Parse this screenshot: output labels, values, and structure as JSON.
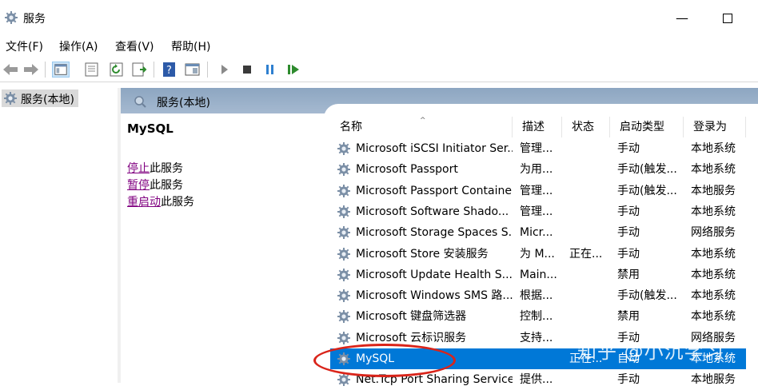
{
  "window": {
    "title": "服务"
  },
  "menu": [
    "文件(F)",
    "操作(A)",
    "查看(V)",
    "帮助(H)"
  ],
  "toolbar": [
    {
      "name": "back-arrow-icon"
    },
    {
      "name": "forward-arrow-icon"
    },
    {
      "name": "console-tree-icon"
    },
    {
      "name": "properties-sheet-icon"
    },
    {
      "name": "refresh-icon"
    },
    {
      "name": "export-list-icon"
    },
    {
      "name": "help-icon"
    },
    {
      "name": "view-icon"
    },
    {
      "name": "start-service-icon"
    },
    {
      "name": "stop-service-icon"
    },
    {
      "name": "pause-service-icon"
    },
    {
      "name": "resume-service-icon"
    }
  ],
  "tree": {
    "item": "服务(本地)"
  },
  "header": {
    "title": "服务(本地)"
  },
  "desc": {
    "service_name": "MySQL",
    "actions": [
      {
        "link": "停止",
        "rest": "此服务"
      },
      {
        "link": "暂停",
        "rest": "此服务"
      },
      {
        "link": "重启动",
        "rest": "此服务"
      }
    ]
  },
  "list": {
    "columns": [
      "名称",
      "描述",
      "状态",
      "启动类型",
      "登录为"
    ],
    "rows": [
      {
        "name": "Microsoft iSCSI Initiator Ser...",
        "desc": "管理...",
        "status": "",
        "startup": "手动",
        "logon": "本地系统"
      },
      {
        "name": "Microsoft Passport",
        "desc": "为用...",
        "status": "",
        "startup": "手动(触发...",
        "logon": "本地系统"
      },
      {
        "name": "Microsoft Passport Container",
        "desc": "管理...",
        "status": "",
        "startup": "手动(触发...",
        "logon": "本地服务"
      },
      {
        "name": "Microsoft Software Shado...",
        "desc": "管理...",
        "status": "",
        "startup": "手动",
        "logon": "本地系统"
      },
      {
        "name": "Microsoft Storage Spaces S...",
        "desc": "Micr...",
        "status": "",
        "startup": "手动",
        "logon": "网络服务"
      },
      {
        "name": "Microsoft Store 安装服务",
        "desc": "为 M...",
        "status": "正在...",
        "startup": "手动",
        "logon": "本地系统"
      },
      {
        "name": "Microsoft Update Health S...",
        "desc": "Main...",
        "status": "",
        "startup": "禁用",
        "logon": "本地系统"
      },
      {
        "name": "Microsoft Windows SMS 路...",
        "desc": "根据...",
        "status": "",
        "startup": "手动(触发...",
        "logon": "本地系统"
      },
      {
        "name": "Microsoft 键盘筛选器",
        "desc": "控制...",
        "status": "",
        "startup": "禁用",
        "logon": "本地系统"
      },
      {
        "name": "Microsoft 云标识服务",
        "desc": "支持...",
        "status": "",
        "startup": "手动",
        "logon": "网络服务"
      },
      {
        "name": "MySQL",
        "desc": "",
        "status": "正在...",
        "startup": "自动",
        "logon": "本地系统",
        "selected": true
      },
      {
        "name": "Net.Tcp Port Sharing Service",
        "desc": "提供...",
        "status": "",
        "startup": "手动",
        "logon": "本地服务"
      }
    ]
  },
  "watermark": "知乎 @小沉学习",
  "colors": {
    "selection": "#0078d7",
    "header": "#9fb4cc",
    "annotation": "#d9241a",
    "link": "#800080"
  }
}
